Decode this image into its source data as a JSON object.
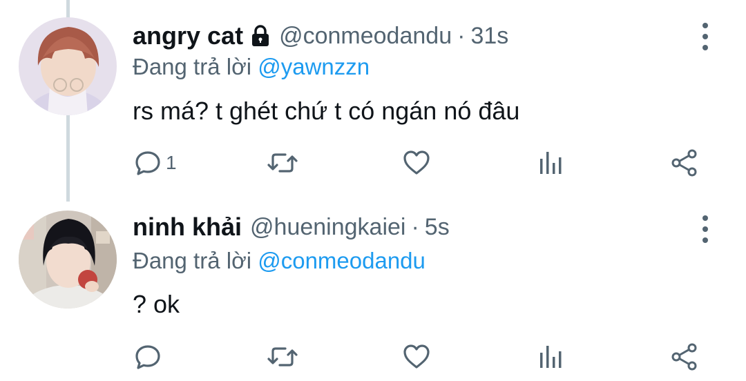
{
  "colors": {
    "accent": "#1d9bf0",
    "secondary_text": "#536471",
    "primary_text": "#0f1419",
    "thread_line": "#cfd9de"
  },
  "tweets": [
    {
      "name": "angry cat",
      "protected_icon": "lock-icon",
      "handle": "@conmeodandu",
      "separator": "·",
      "time": "31s",
      "replying_prefix": "Đang trả lời",
      "replying_to": "@yawnzzn",
      "text": "rs má? t ghét chứ t có ngán nó đâu",
      "reply_count": "1",
      "actions": [
        "reply-icon",
        "retweet-icon",
        "like-icon",
        "analytics-icon",
        "share-icon"
      ]
    },
    {
      "name": "ninh khải",
      "handle": "@hueningkaiei",
      "separator": "·",
      "time": "5s",
      "replying_prefix": "Đang trả lời",
      "replying_to": "@conmeodandu",
      "text": "? ok",
      "reply_count": "",
      "actions": [
        "reply-icon",
        "retweet-icon",
        "like-icon",
        "analytics-icon",
        "share-icon"
      ]
    }
  ]
}
